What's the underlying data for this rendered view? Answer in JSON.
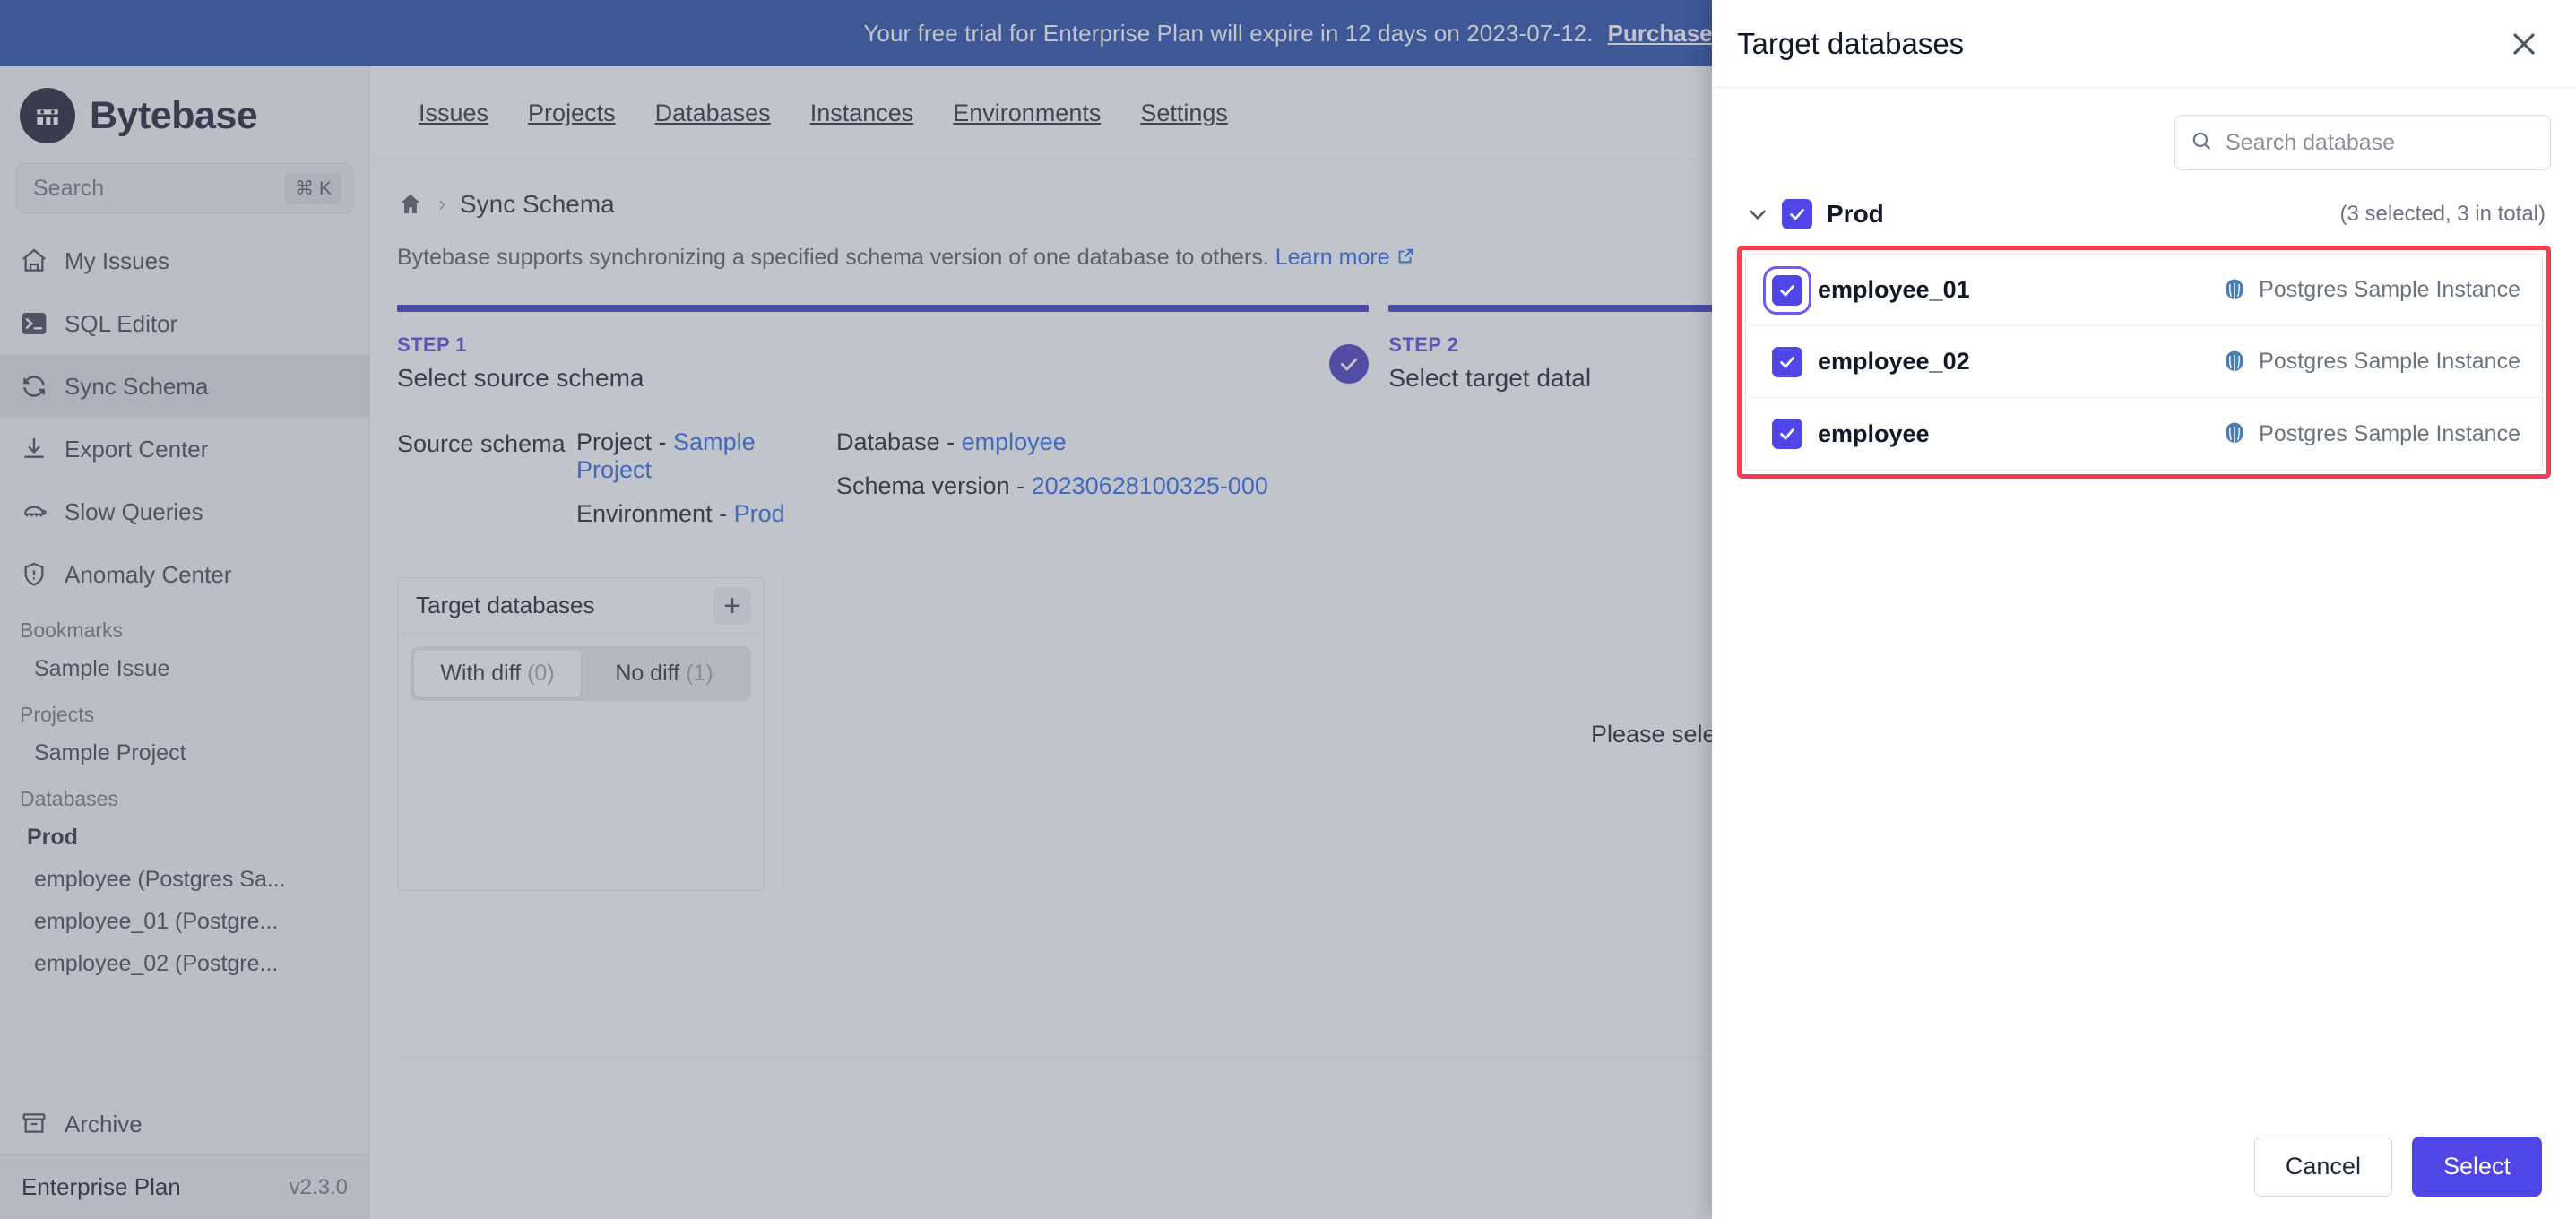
{
  "banner": {
    "message": "Your free trial for Enterprise Plan will expire in 12 days on 2023-07-12.",
    "link": "Purchase",
    "bg_color": "#1e44a8"
  },
  "sidebar": {
    "brand": "Bytebase",
    "search": {
      "placeholder": "Search",
      "shortcut": "⌘ K"
    },
    "nav": [
      {
        "label": "My Issues",
        "icon": "home-icon"
      },
      {
        "label": "SQL Editor",
        "icon": "terminal-icon"
      },
      {
        "label": "Sync Schema",
        "icon": "sync-icon",
        "active": true
      },
      {
        "label": "Export Center",
        "icon": "download-icon"
      },
      {
        "label": "Slow Queries",
        "icon": "turtle-icon"
      },
      {
        "label": "Anomaly Center",
        "icon": "shield-alert-icon"
      }
    ],
    "groups": [
      {
        "title": "Bookmarks",
        "items": [
          {
            "label": "Sample Issue"
          }
        ]
      },
      {
        "title": "Projects",
        "items": [
          {
            "label": "Sample Project"
          }
        ]
      },
      {
        "title": "Databases",
        "items": [
          {
            "label": "Prod",
            "bold": true
          },
          {
            "label": "employee (Postgres Sa..."
          },
          {
            "label": "employee_01 (Postgre..."
          },
          {
            "label": "employee_02 (Postgre..."
          }
        ]
      }
    ],
    "archive": {
      "label": "Archive",
      "icon": "archive-icon"
    },
    "plan": {
      "name": "Enterprise Plan",
      "version": "v2.3.0"
    }
  },
  "topnav": [
    {
      "label": "Issues"
    },
    {
      "label": "Projects"
    },
    {
      "label": "Databases"
    },
    {
      "label": "Instances"
    },
    {
      "label": "Environments"
    },
    {
      "label": "Settings"
    }
  ],
  "main": {
    "breadcrumb": {
      "home_icon": "home-icon",
      "separator": "›",
      "current": "Sync Schema"
    },
    "subtitle": "Bytebase supports synchronizing a specified schema version of one database to others.",
    "subtitle_link": "Learn more",
    "steps": [
      {
        "label": "STEP 1",
        "title": "Select source schema",
        "completed": true
      },
      {
        "label": "STEP 2",
        "title": "Select target datal",
        "completed": false
      }
    ],
    "source": {
      "label": "Source schema",
      "project_key": "Project -",
      "project_value": "Sample Project",
      "environment_key": "Environment -",
      "environment_value": "Prod",
      "database_key": "Database -",
      "database_value": "employee",
      "schema_version_key": "Schema version -",
      "schema_version_value": "20230628100325-000"
    },
    "panel": {
      "title": "Target databases",
      "add_icon": "plus-icon",
      "tabs": [
        {
          "label": "With diff",
          "count": "(0)",
          "selected": true
        },
        {
          "label": "No diff",
          "count": "(1)",
          "selected": false
        }
      ]
    },
    "empty_state": "Please select a t"
  },
  "modal": {
    "title": "Target databases",
    "close_icon": "close-icon",
    "search": {
      "placeholder": "Search database",
      "value": "",
      "icon": "search-icon"
    },
    "environment": {
      "name": "Prod",
      "checked": true,
      "count_text": "(3 selected, 3 in total)",
      "chevron": "chevron-down-icon"
    },
    "highlight_color": "#f43f4e",
    "accent_color": "#4f46e5",
    "databases": [
      {
        "name": "employee_01",
        "instance": "Postgres Sample Instance",
        "checked": true,
        "focused": true
      },
      {
        "name": "employee_02",
        "instance": "Postgres Sample Instance",
        "checked": true,
        "focused": false
      },
      {
        "name": "employee",
        "instance": "Postgres Sample Instance",
        "checked": true,
        "focused": false
      }
    ],
    "footer": {
      "cancel": "Cancel",
      "select": "Select"
    }
  }
}
